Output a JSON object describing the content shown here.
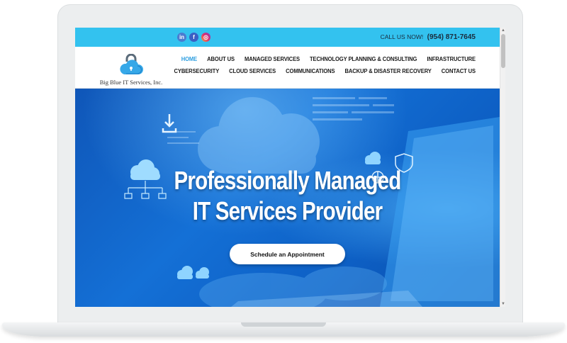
{
  "topbar": {
    "call_label": "CALL US NOW!",
    "phone": "(954) 871-7645",
    "social_icons": [
      "linkedin-icon",
      "facebook-icon",
      "instagram-icon"
    ]
  },
  "brand": {
    "name": "Big Blue IT Services, Inc.",
    "accent": "#33c2ef",
    "nav_active_color": "#2f9fe0"
  },
  "nav": {
    "row1": [
      "HOME",
      "ABOUT US",
      "MANAGED SERVICES",
      "TECHNOLOGY PLANNING & CONSULTING",
      "INFRASTRUCTURE"
    ],
    "row2": [
      "CYBERSECURITY",
      "CLOUD SERVICES",
      "COMMUNICATIONS",
      "BACKUP & DISASTER RECOVERY",
      "CONTACT US"
    ],
    "active": "HOME"
  },
  "hero": {
    "headline_line1": "Professionally Managed",
    "headline_line2": "IT Services Provider",
    "cta_label": "Schedule an Appointment"
  }
}
